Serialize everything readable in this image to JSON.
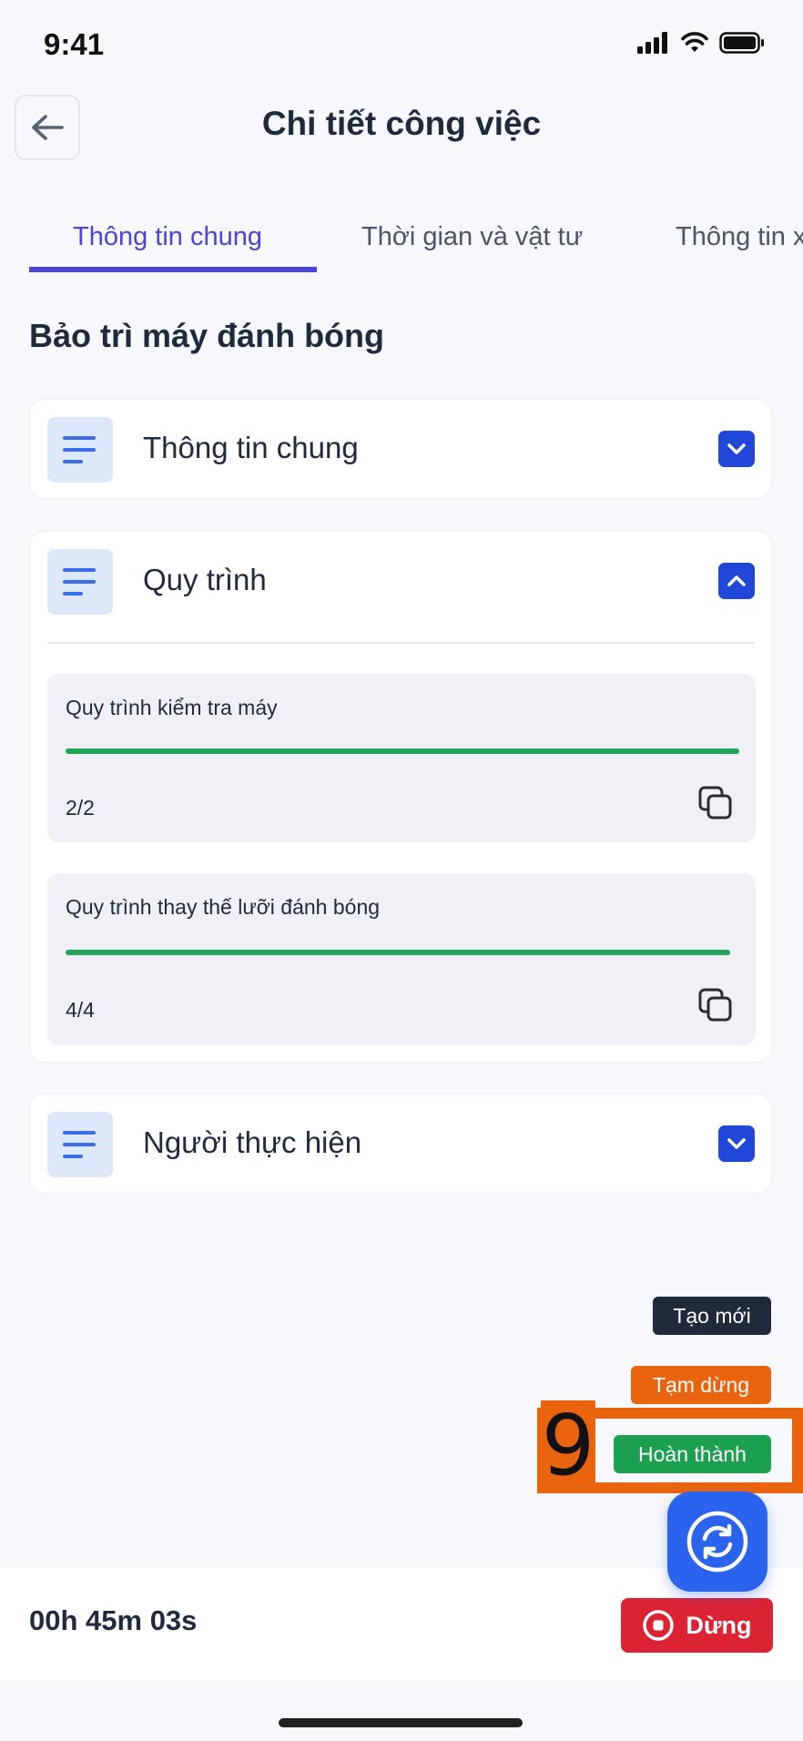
{
  "status_bar": {
    "time": "9:41"
  },
  "header": {
    "title": "Chi tiết công việc"
  },
  "tabs": [
    {
      "label": "Thông tin chung",
      "active": true
    },
    {
      "label": "Thời gian và vật tư",
      "active": false
    },
    {
      "label": "Thông tin x",
      "active": false
    }
  ],
  "work_title": "Bảo trì máy đánh bóng",
  "sections": [
    {
      "title": "Thông tin chung",
      "expanded": false
    },
    {
      "title": "Quy trình",
      "expanded": true
    },
    {
      "title": "Người thực hiện",
      "expanded": false
    }
  ],
  "procedures": [
    {
      "name": "Quy trình kiểm tra máy",
      "progress": "2/2",
      "progress_fraction": 1.0
    },
    {
      "name": "Quy trình thay thế lưỡi đánh bóng",
      "progress": "4/4",
      "progress_fraction": 1.0
    }
  ],
  "fab_actions": {
    "create": "Tạo mới",
    "pause": "Tạm dừng",
    "complete": "Hoàn thành",
    "highlight_number": "9"
  },
  "bottom_bar": {
    "timer": "00h 45m 03s",
    "stop_label": "Dừng"
  },
  "colors": {
    "primary": "#4a45d6",
    "toggle": "#2147d9",
    "progress": "#22a55a",
    "create": "#1f2a3d",
    "pause": "#ea640f",
    "complete": "#1aa04f",
    "stop": "#dc2334",
    "fab": "#2a63ee"
  },
  "icons": {
    "back": "arrow-left-icon",
    "section": "lines-icon",
    "toggle_collapsed": "chevron-down-icon",
    "toggle_expanded": "chevron-up-icon",
    "copy": "copy-icon",
    "fab": "sync-icon",
    "stop": "stop-circle-icon"
  }
}
